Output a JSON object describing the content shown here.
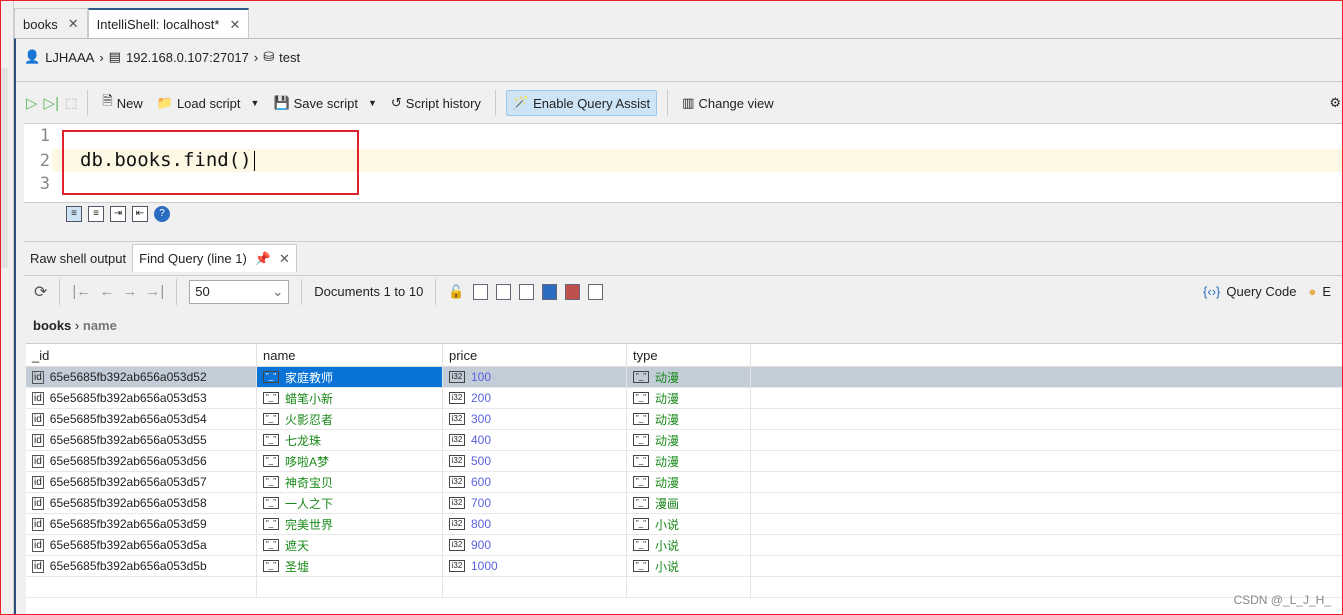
{
  "tabs": [
    {
      "label": "books"
    },
    {
      "label": "IntelliShell: localhost*"
    }
  ],
  "breadcrumb": {
    "user": "LJHAAA",
    "server": "192.168.0.107:27017",
    "database": "test"
  },
  "toolbar": {
    "new": "New",
    "load": "Load script",
    "save": "Save script",
    "history": "Script history",
    "assist": "Enable Query Assist",
    "view": "Change view"
  },
  "editor": {
    "line_numbers": [
      "1",
      "2",
      "3"
    ],
    "code": "db.books.find()"
  },
  "result_tabs": [
    {
      "label": "Raw shell output"
    },
    {
      "label": "Find Query (line 1)"
    }
  ],
  "results_toolbar": {
    "page_size": "50",
    "documents": "Documents 1 to 10",
    "query_code": "Query Code",
    "cut_label": "E"
  },
  "path": {
    "collection": "books",
    "field": "name"
  },
  "table": {
    "columns": [
      "_id",
      "name",
      "price",
      "type"
    ],
    "rows": [
      [
        "65e5685fb392ab656a053d52",
        "家庭教师",
        "100",
        "动漫"
      ],
      [
        "65e5685fb392ab656a053d53",
        "蜡笔小新",
        "200",
        "动漫"
      ],
      [
        "65e5685fb392ab656a053d54",
        "火影忍者",
        "300",
        "动漫"
      ],
      [
        "65e5685fb392ab656a053d55",
        "七龙珠",
        "400",
        "动漫"
      ],
      [
        "65e5685fb392ab656a053d56",
        "哆啦A梦",
        "500",
        "动漫"
      ],
      [
        "65e5685fb392ab656a053d57",
        "神奇宝贝",
        "600",
        "动漫"
      ],
      [
        "65e5685fb392ab656a053d58",
        "一人之下",
        "700",
        "漫画"
      ],
      [
        "65e5685fb392ab656a053d59",
        "完美世界",
        "800",
        "小说"
      ],
      [
        "65e5685fb392ab656a053d5a",
        "遮天",
        "900",
        "小说"
      ],
      [
        "65e5685fb392ab656a053d5b",
        "圣墟",
        "1000",
        "小说"
      ]
    ]
  },
  "watermark": "CSDN @_L_J_H_",
  "colors": {
    "selection": "#0a74d6",
    "string": "#1a8a1a",
    "number": "#5a62e0",
    "highlight_box": "#e0202a"
  }
}
